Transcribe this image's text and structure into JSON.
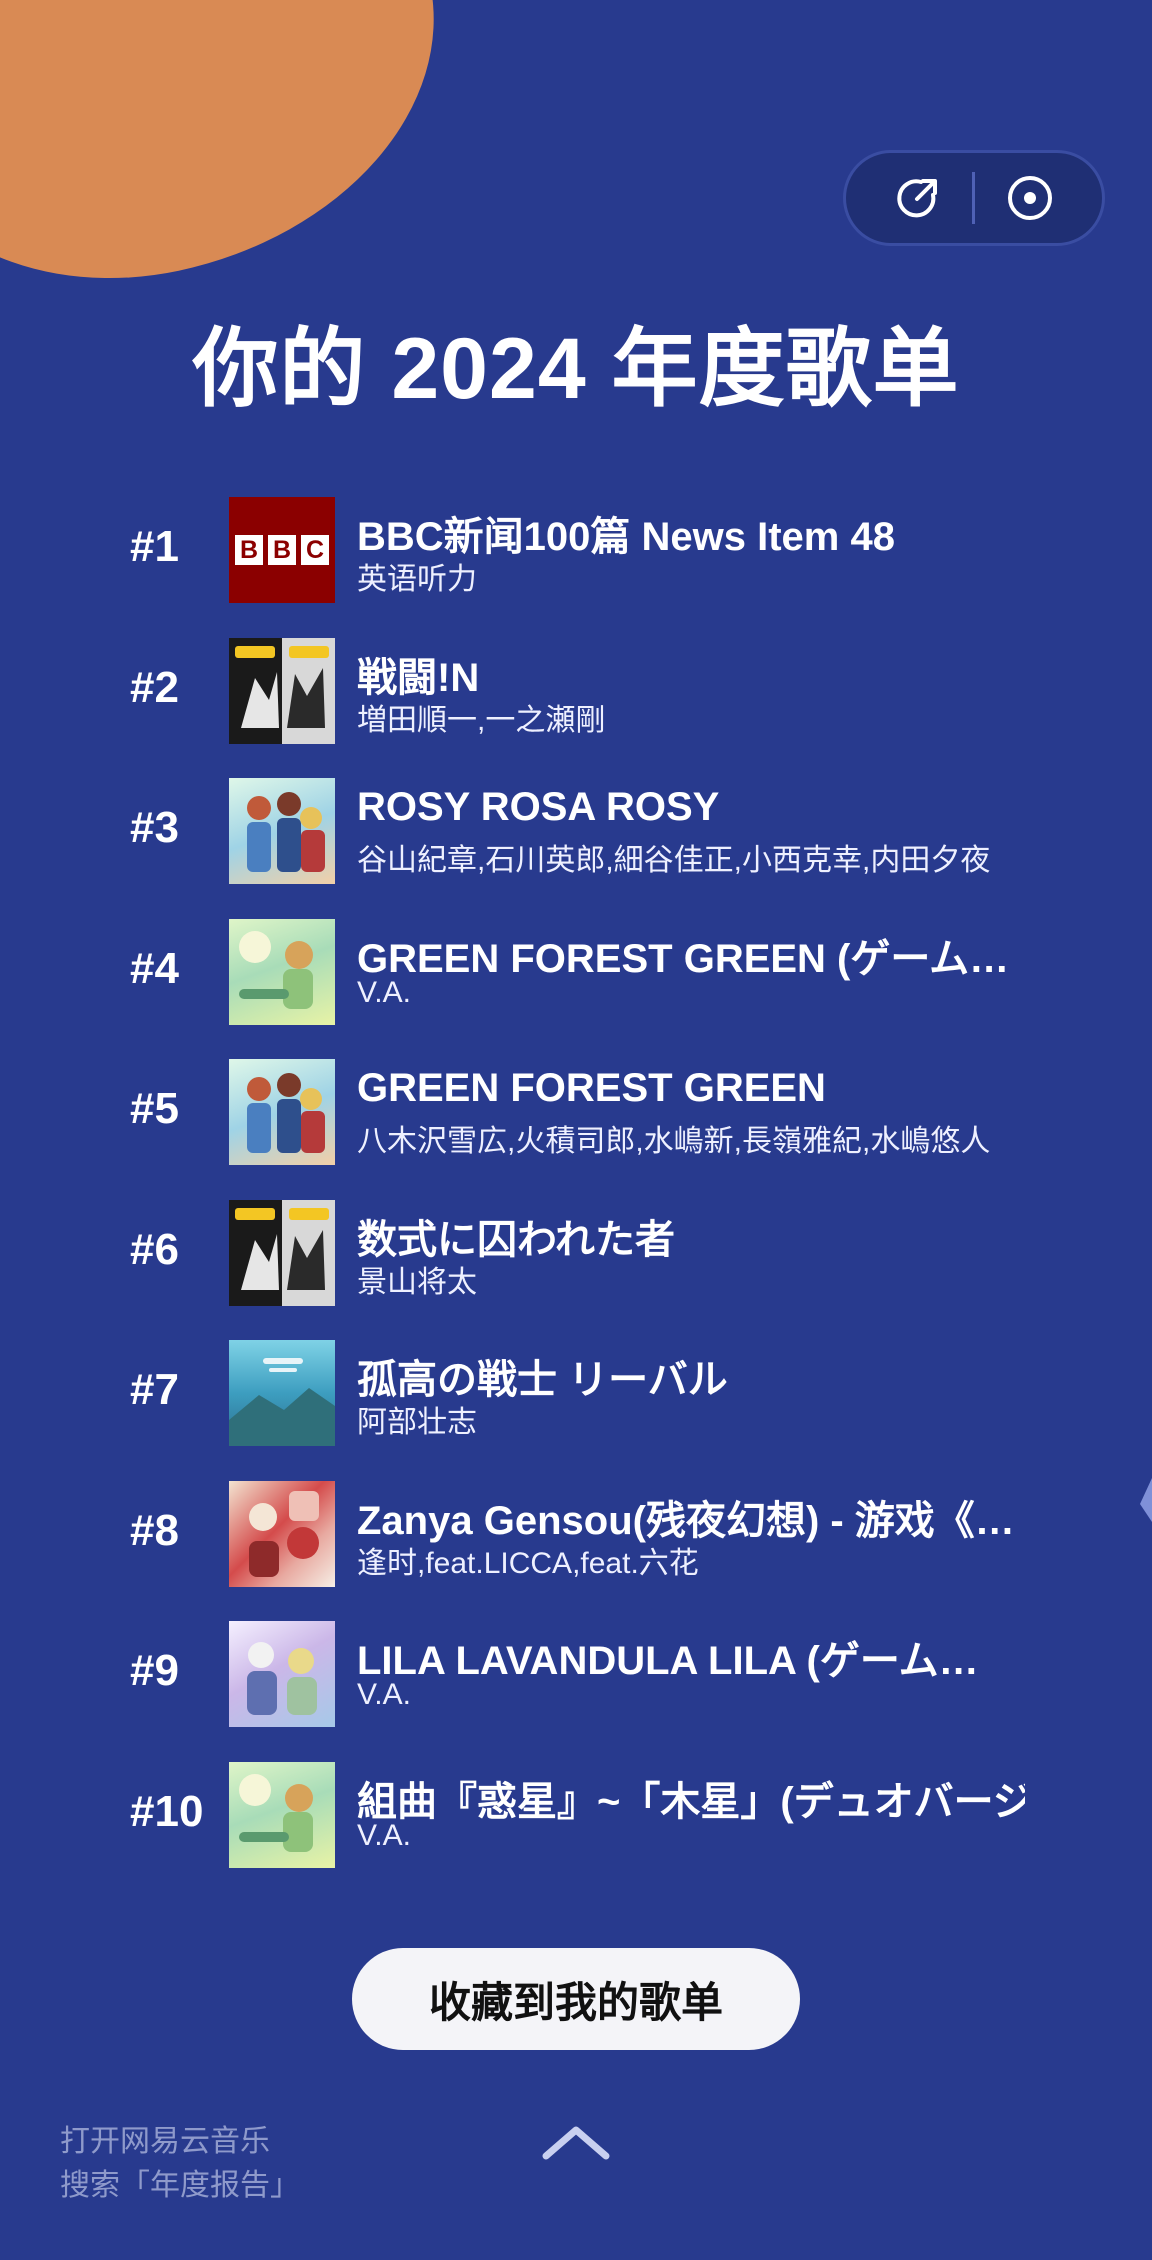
{
  "header": {
    "title": "你的 2024 年度歌单",
    "share_icon": "share-icon",
    "record_icon": "record-icon"
  },
  "songs": [
    {
      "rank": "#1",
      "title": "BBC新闻100篇 News Item 48",
      "artist": "英语听力",
      "cover": "bbc-cover"
    },
    {
      "rank": "#2",
      "title": "戦闘!N",
      "artist": "増田順一,一之瀬剛",
      "cover": "pokemon-black-white-cover"
    },
    {
      "rank": "#3",
      "title": "ROSY ROSA ROSY",
      "artist": "谷山紀章,石川英郎,細谷佳正,小西克幸,内田夕夜",
      "cover": "anime-group-cover"
    },
    {
      "rank": "#4",
      "title": "GREEN FOREST GREEN (ゲーム…",
      "artist": "V.A.",
      "cover": "green-forest-cover"
    },
    {
      "rank": "#5",
      "title": "GREEN FOREST GREEN",
      "artist": "八木沢雪広,火積司郎,水嶋新,長嶺雅紀,水嶋悠人",
      "cover": "anime-group-cover"
    },
    {
      "rank": "#6",
      "title": "数式に囚われた者",
      "artist": "景山将太",
      "cover": "pokemon-black-white-cover"
    },
    {
      "rank": "#7",
      "title": "孤高の戦士 リーバル",
      "artist": "阿部壮志",
      "cover": "zelda-cover"
    },
    {
      "rank": "#8",
      "title": "Zanya Gensou(残夜幻想) - 游戏《…",
      "artist": "逢时,feat.LICCA,feat.六花",
      "cover": "zanya-cover"
    },
    {
      "rank": "#9",
      "title": "LILA LAVANDULA LILA (ゲーム…",
      "artist": "V.A.",
      "cover": "lila-cover"
    },
    {
      "rank": "#10",
      "title": "組曲『惑星』~「木星」(デュオバージ…",
      "artist": "V.A.",
      "cover": "green-forest-cover"
    }
  ],
  "actions": {
    "save_playlist_label": "收藏到我的歌单"
  },
  "footer": {
    "hint_line1": "打开网易云音乐",
    "hint_line2": "搜索「年度报告」",
    "up_icon": "chevron-up-icon"
  },
  "colors": {
    "background": "#283a8e",
    "button_bg": "#f4f4f8",
    "hint_text": "#8f9acb"
  }
}
